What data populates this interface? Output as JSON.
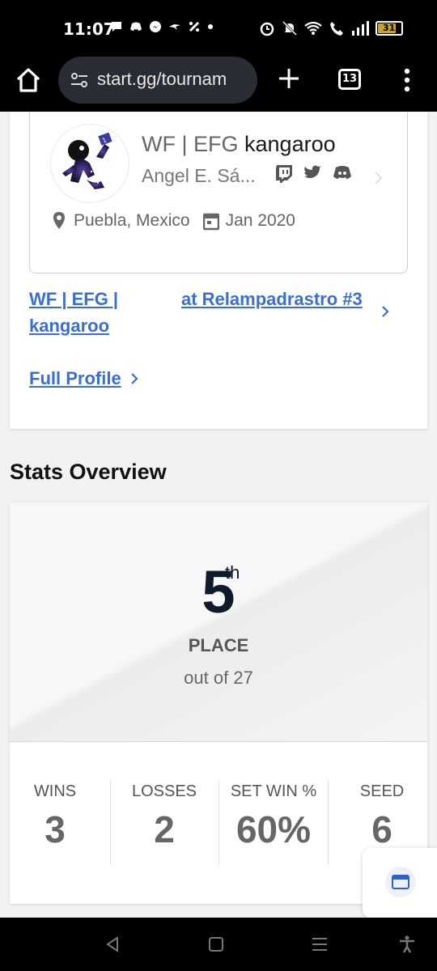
{
  "status_bar": {
    "time": "11:07",
    "battery": "31",
    "left_icons": [
      "chat-icon",
      "discord-icon",
      "messenger-icon",
      "bird-icon",
      "percent-icon",
      "dot-icon"
    ],
    "right_icons": [
      "alarm-icon",
      "mute-icon",
      "wifi-icon",
      "call-icon",
      "signal-icon",
      "battery-icon"
    ]
  },
  "browser": {
    "url": "start.gg/tournam",
    "tab_count": "13"
  },
  "profile": {
    "prefix": "WF | EFG",
    "gamer_tag": "kangaroo",
    "real_name": "Angel E. Sá...",
    "social_icons": [
      "twitch-icon",
      "twitter-icon",
      "discord-icon"
    ],
    "location": "Puebla, Mexico",
    "joined": "Jan 2020"
  },
  "links": {
    "player_link": "WF | EFG | kangaroo",
    "event_link": "at Relampadrastro #3",
    "full_profile": "Full Profile"
  },
  "stats": {
    "section_title": "Stats Overview",
    "place_number": "5",
    "place_suffix": "th",
    "place_label": "PLACE",
    "out_of": "out of 27",
    "columns": [
      {
        "label": "WINS",
        "value": "3"
      },
      {
        "label": "LOSSES",
        "value": "2"
      },
      {
        "label": "SET WIN %",
        "value": "60%"
      },
      {
        "label": "SEED",
        "value": "6"
      }
    ]
  },
  "colors": {
    "link_blue": "#3a6fd0",
    "dark_text": "#0f1a2a",
    "browser_bg": "#000000"
  }
}
